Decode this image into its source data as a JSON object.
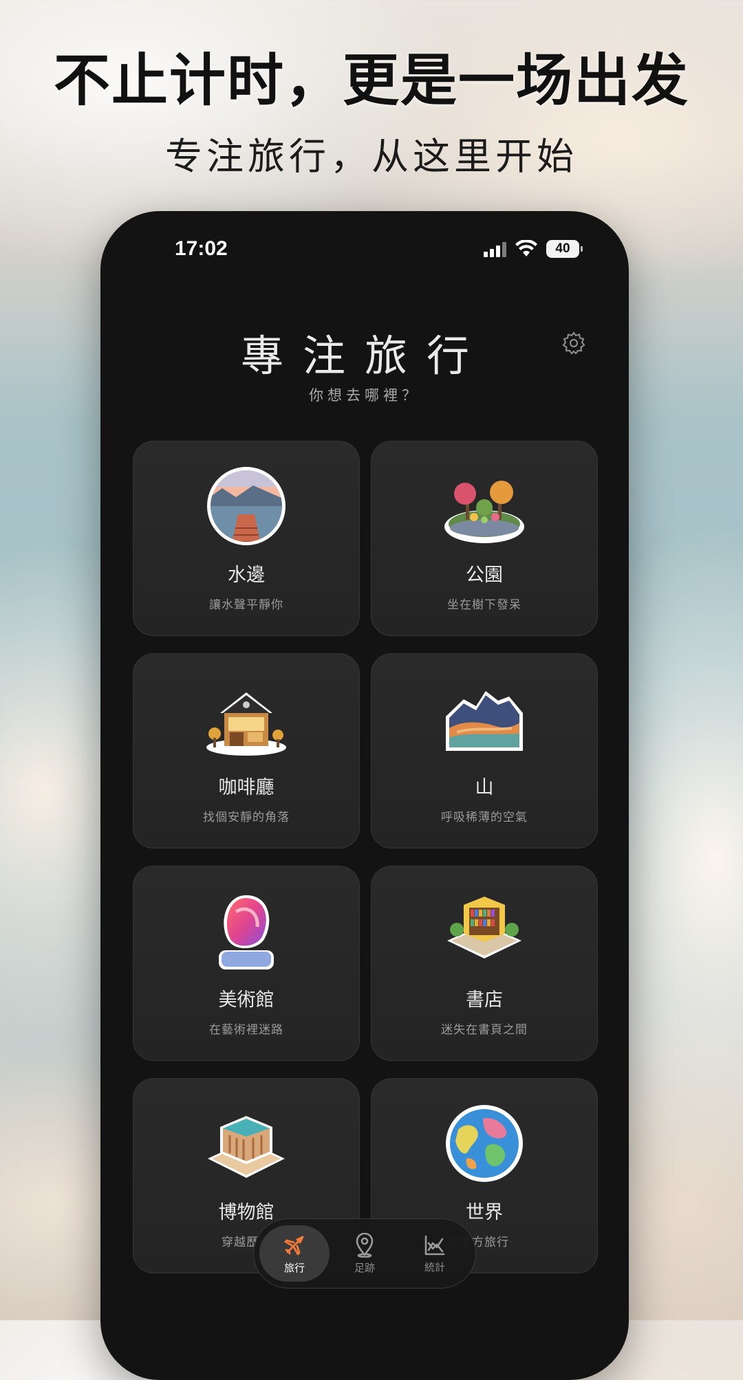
{
  "promo": {
    "headline": "不止计时，更是一场出发",
    "subhead": "专注旅行，从这里开始"
  },
  "status_bar": {
    "time": "17:02",
    "battery": "40",
    "icons": [
      "signal-icon",
      "wifi-icon",
      "battery-icon"
    ]
  },
  "header": {
    "title": "專注旅行",
    "subtitle": "你想去哪裡？",
    "settings_icon": "gear-icon"
  },
  "destinations": [
    {
      "name": "水邊",
      "desc": "讓水聲平靜你",
      "icon": "lake-dock-icon"
    },
    {
      "name": "公園",
      "desc": "坐在樹下發呆",
      "icon": "park-icon"
    },
    {
      "name": "咖啡廳",
      "desc": "找個安靜的角落",
      "icon": "cafe-icon"
    },
    {
      "name": "山",
      "desc": "呼吸稀薄的空氣",
      "icon": "mountain-icon"
    },
    {
      "name": "美術館",
      "desc": "在藝術裡迷路",
      "icon": "art-sculpture-icon"
    },
    {
      "name": "書店",
      "desc": "迷失在書頁之間",
      "icon": "bookstore-icon"
    },
    {
      "name": "博物館",
      "desc": "穿越歷史",
      "icon": "museum-icon"
    },
    {
      "name": "世界",
      "desc": "的地方旅行",
      "icon": "globe-icon"
    }
  ],
  "tabbar": {
    "tabs": [
      {
        "label": "旅行",
        "icon": "airplane-icon",
        "active": true
      },
      {
        "label": "足跡",
        "icon": "location-pin-icon",
        "active": false
      },
      {
        "label": "統計",
        "icon": "chart-icon",
        "active": false
      }
    ]
  },
  "colors": {
    "phone_bg": "#131313",
    "card_bg": "#2a2a2a",
    "accent": "#f07a3a"
  }
}
